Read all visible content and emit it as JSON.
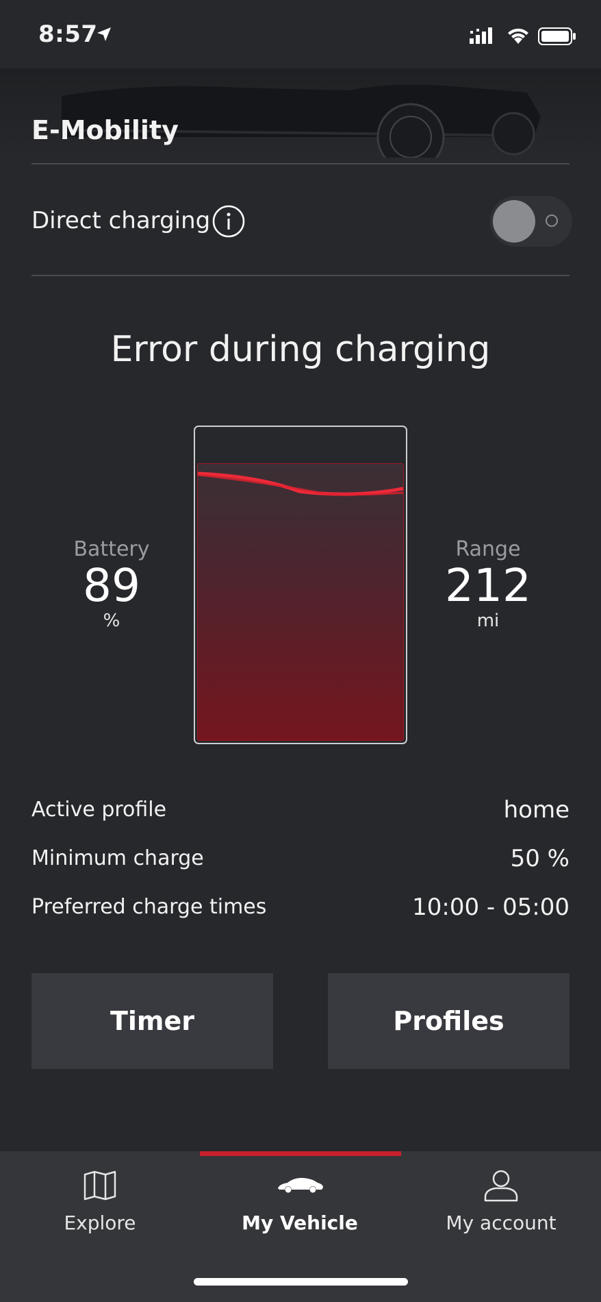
{
  "status_bar": {
    "time": "8:57",
    "icons": [
      "location-arrow-icon",
      "cellular-signal-icon",
      "wifi-icon",
      "battery-icon"
    ]
  },
  "header": {
    "title": "E-Mobility"
  },
  "direct_charging": {
    "label": "Direct charging",
    "info_icon": "info-icon",
    "enabled": false
  },
  "charging": {
    "status": "Error during charging",
    "battery": {
      "label": "Battery",
      "value": "89",
      "unit": "%",
      "level": 0.89
    },
    "range": {
      "label": "Range",
      "value": "212",
      "unit": "mi"
    }
  },
  "profile_info": [
    {
      "key": "Active profile",
      "value": "home"
    },
    {
      "key": "Minimum charge",
      "value": "50 %"
    },
    {
      "key": "Preferred charge times",
      "value": "10:00 - 05:00"
    }
  ],
  "actions": {
    "timer_label": "Timer",
    "profiles_label": "Profiles"
  },
  "tabbar": {
    "tabs": [
      {
        "label": "Explore",
        "icon": "map-icon",
        "active": false
      },
      {
        "label": "My Vehicle",
        "icon": "car-icon",
        "active": true
      },
      {
        "label": "My account",
        "icon": "user-icon",
        "active": false
      }
    ]
  },
  "colors": {
    "background": "#27282c",
    "accent": "#c8202e",
    "battery_fill": "#75161f"
  }
}
